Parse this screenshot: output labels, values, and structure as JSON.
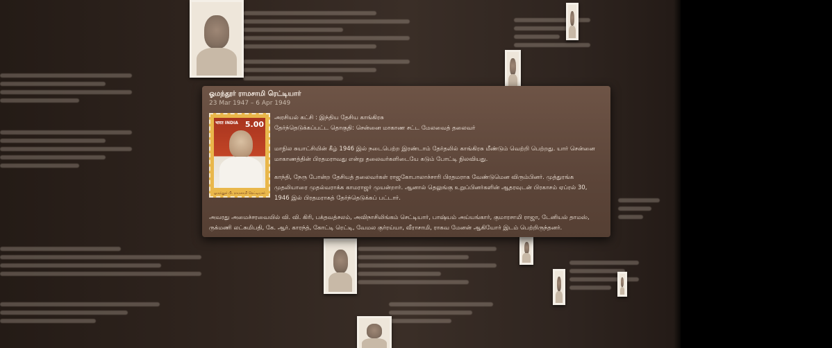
{
  "popup": {
    "name": "ஓமந்தூர் ராமசாமி ரெட்டியார்",
    "dates": "23 Mar 1947 – 6 Apr 1949",
    "party": "அரசியல் கட்சி : இந்திய தேசிய காங்கிரசு",
    "seat": "தேர்ந்தெடுக்கப்பட்ட தொகுதி: சென்னை மாகாண சட்ட மேலவைத் தலைவர்",
    "para1": "மாநில சுயாட்சியின் கீழ் 1946 இல் நடைபெற்ற இரண்டாம் தேர்தலில் காங்கிரசு மீண்டும் வெற்றி பெற்றது. யார் சென்னை மாகாணத்தின் பிரதமராவது என்று தலைவர்களிடையே கடும் போட்டி நிலவியது.",
    "para2": "காந்தி, நேரு போன்ற தேசியத் தலைவர்கள் ராஜகோபாலாச்சாரி பிரதமராக வேண்டுமென விரும்பினர். முத்துரங்க முதலியாரை முதல்வராக்க காமராஜர் முயன்றார். ஆனால் தெலுங்கு உறுப்பினர்களின் ஆதரவுடன் பிரகாசம் ஏப்ரல் 30, 1946 இல் பிரதமராகத் தேர்ந்தெடுக்கப் பட்டார்.",
    "para3": "அவரது அமைச்சரவையில் வி. வி. கிரி, பக்தவத்சலம், அவிநாசிலிங்கம் செட்டியார், பாஷ்யம் அய்யங்கார், குமாரசாமி ராஜா, டேனியல் தாமஸ், ருக்மணி லட்சுமிபதி, கே. ஆர். காரந்த், கோட்டி ரெட்டி, வேமல குர்ரய்யா, வீராசாமி, ராகவ மேனன் ஆகியோர் இடம் பெற்றிருந்தனர்."
  },
  "stamp": {
    "country": "भारत INDIA",
    "value": "5.00",
    "caption": "ஓமந்தூர் பி. ராமசாமி ரெட்டியார்"
  }
}
